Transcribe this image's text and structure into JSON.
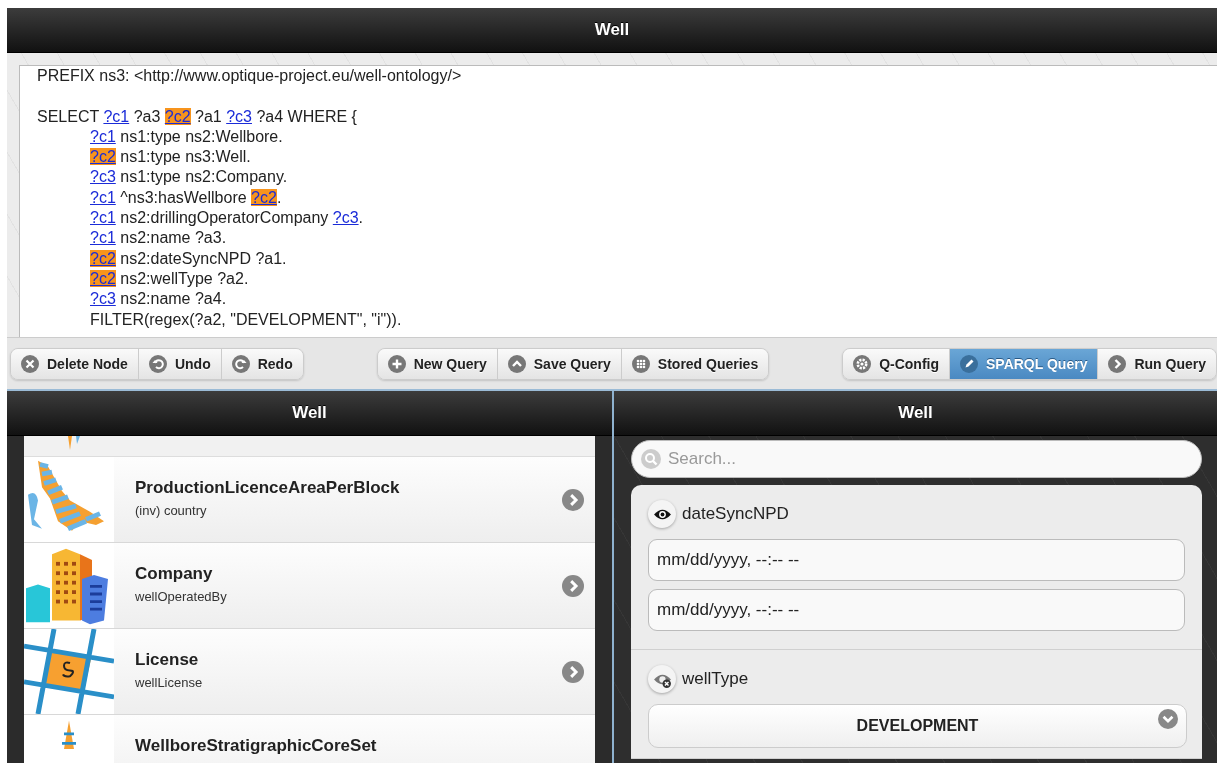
{
  "window": {
    "title": "Well"
  },
  "query": {
    "prefixes": [
      [
        {
          "text": "PREFIX ns3: <http://www.optique-project.eu/well-ontology/>",
          "kind": "plain"
        }
      ]
    ],
    "select": {
      "head": [
        {
          "text": "SELECT ",
          "kind": "plain"
        },
        {
          "text": "?c1",
          "kind": "var",
          "highlighted": false
        },
        {
          "text": " ?a3 ",
          "kind": "plain"
        },
        {
          "text": "?c2",
          "kind": "var",
          "highlighted": true
        },
        {
          "text": " ?a1 ",
          "kind": "plain"
        },
        {
          "text": "?c3",
          "kind": "var",
          "highlighted": false
        },
        {
          "text": " ?a4 WHERE {",
          "kind": "plain"
        }
      ],
      "body": [
        [
          {
            "text": "?c1",
            "kind": "var",
            "highlighted": false
          },
          {
            "text": " ns1:type ns2:Wellbore.",
            "kind": "plain"
          }
        ],
        [
          {
            "text": "?c2",
            "kind": "var",
            "highlighted": true
          },
          {
            "text": " ns1:type ns3:Well.",
            "kind": "plain"
          }
        ],
        [
          {
            "text": "?c3",
            "kind": "var",
            "highlighted": false
          },
          {
            "text": " ns1:type ns2:Company.",
            "kind": "plain"
          }
        ],
        [
          {
            "text": "?c1",
            "kind": "var",
            "highlighted": false
          },
          {
            "text": " ^ns3:hasWellbore ",
            "kind": "plain"
          },
          {
            "text": "?c2",
            "kind": "var",
            "highlighted": true
          },
          {
            "text": ".",
            "kind": "plain"
          }
        ],
        [
          {
            "text": "?c1",
            "kind": "var",
            "highlighted": false
          },
          {
            "text": " ns2:drillingOperatorCompany ",
            "kind": "plain"
          },
          {
            "text": "?c3",
            "kind": "var",
            "highlighted": false
          },
          {
            "text": ".",
            "kind": "plain"
          }
        ],
        [
          {
            "text": "?c1",
            "kind": "var",
            "highlighted": false
          },
          {
            "text": " ns2:name ?a3.",
            "kind": "plain"
          }
        ],
        [
          {
            "text": "?c2",
            "kind": "var",
            "highlighted": true
          },
          {
            "text": " ns2:dateSyncNPD ?a1.",
            "kind": "plain"
          }
        ],
        [
          {
            "text": "?c2",
            "kind": "var",
            "highlighted": true
          },
          {
            "text": " ns2:wellType ?a2.",
            "kind": "plain"
          }
        ],
        [
          {
            "text": "?c3",
            "kind": "var",
            "highlighted": false
          },
          {
            "text": " ns2:name ?a4.",
            "kind": "plain"
          }
        ],
        [
          {
            "text": "FILTER(regex(?a2, \"DEVELOPMENT\", \"i\")).",
            "kind": "plain"
          }
        ]
      ]
    }
  },
  "toolbar": {
    "groups": [
      {
        "buttons": [
          {
            "label": "Delete Node",
            "selected": false
          },
          {
            "label": "Undo",
            "selected": false
          },
          {
            "label": "Redo",
            "selected": false
          }
        ]
      },
      {
        "buttons": [
          {
            "label": "New Query",
            "selected": false
          },
          {
            "label": "Save Query",
            "selected": false
          },
          {
            "label": "Stored Queries",
            "selected": false
          }
        ]
      },
      {
        "buttons": [
          {
            "label": "Q-Config",
            "selected": false
          },
          {
            "label": "SPARQL Query",
            "selected": true
          },
          {
            "label": "Run Query",
            "selected": false
          }
        ]
      }
    ]
  },
  "nav_panel": {
    "title": "Well",
    "items": [
      {
        "title": "ProductionLicenceAreaPerBlock",
        "subtitle": "(inv) country"
      },
      {
        "title": "Company",
        "subtitle": "wellOperatedBy"
      },
      {
        "title": "License",
        "subtitle": "wellLicense"
      },
      {
        "title": "WellboreStratigraphicCoreSet"
      }
    ]
  },
  "facet_panel": {
    "title": "Well",
    "search": {
      "placeholder": "Search..."
    },
    "facets": [
      {
        "name": "dateSyncNPD",
        "visible": true,
        "kind": "date-range",
        "fields": [
          {
            "placeholder": "mm/dd/yyyy, --:-- --"
          },
          {
            "placeholder": "mm/dd/yyyy, --:-- --"
          }
        ]
      },
      {
        "name": "wellType",
        "visible": false,
        "kind": "select",
        "value": "DEVELOPMENT"
      }
    ]
  }
}
